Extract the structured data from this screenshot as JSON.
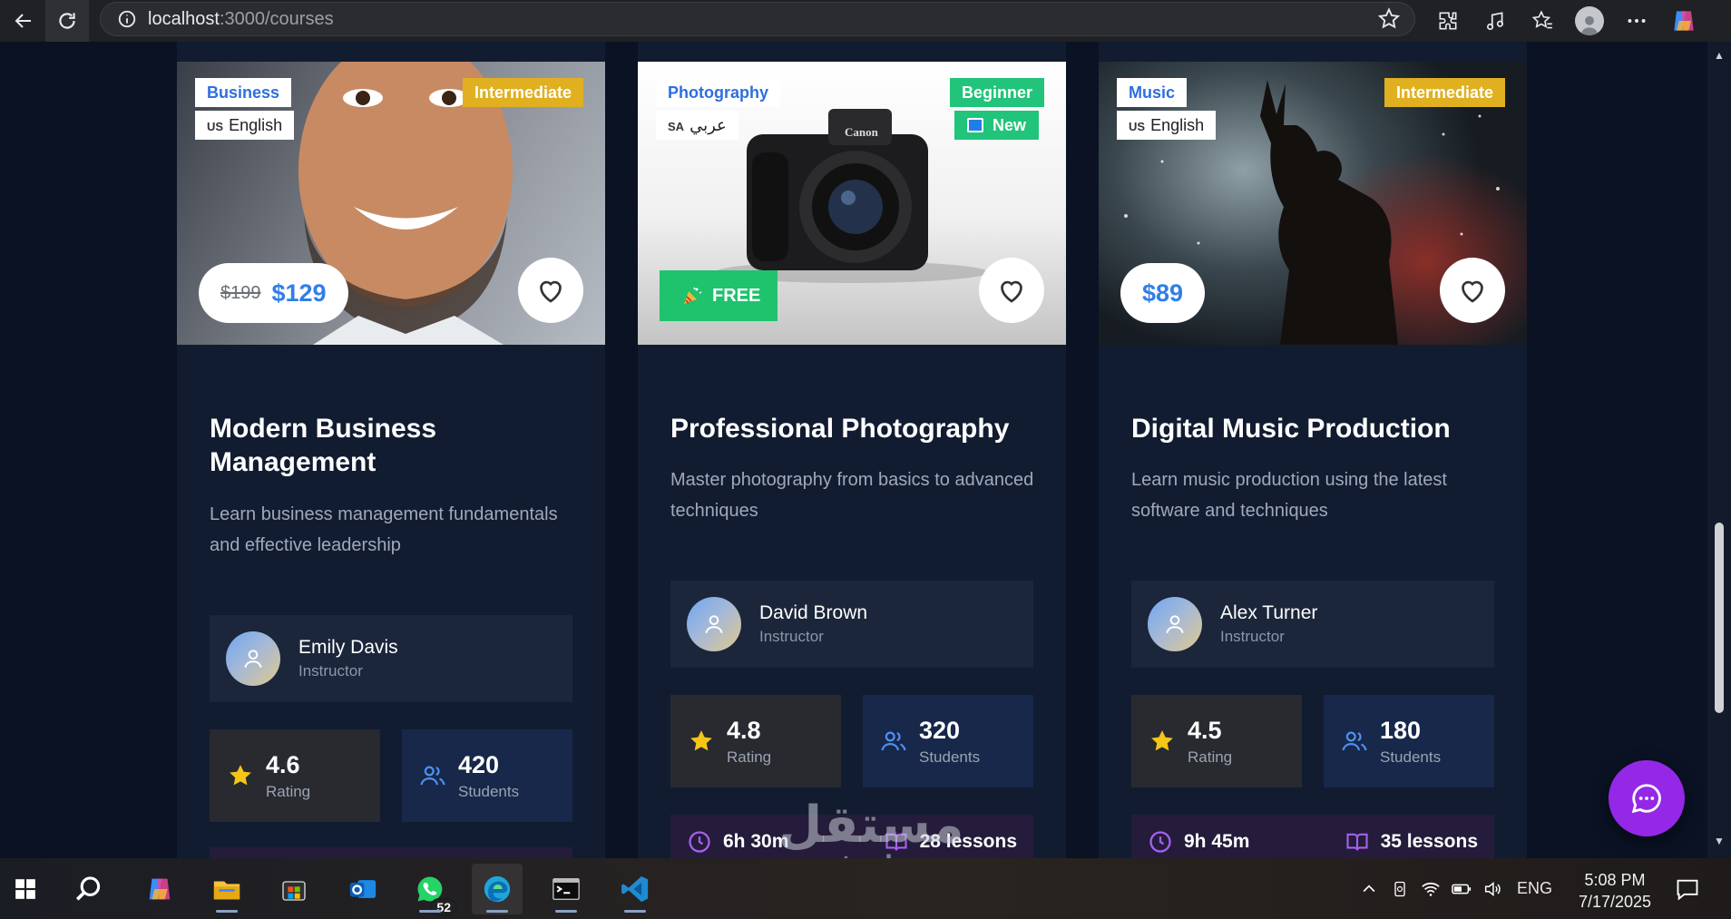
{
  "browser": {
    "url_host": "localhost",
    "url_path": ":3000/courses"
  },
  "courses": [
    {
      "category": "Business",
      "level": "Intermediate",
      "level_color": "#e0b020",
      "lang_code": "US",
      "language": "English",
      "price_old": "$199",
      "price": "$129",
      "title": "Modern Business Management",
      "description": "Learn business management fundamentals and effective leadership",
      "instructor_name": "Emily Davis",
      "instructor_role": "Instructor",
      "rating": "4.6",
      "rating_label": "Rating",
      "students": "420",
      "students_label": "Students"
    },
    {
      "category": "Photography",
      "level": "Beginner",
      "level_color": "#22c37a",
      "new_label": "New",
      "lang_code": "SA",
      "language": "عربي",
      "free_label": "FREE",
      "title": "Professional Photography",
      "description": "Master photography from basics to advanced techniques",
      "instructor_name": "David Brown",
      "instructor_role": "Instructor",
      "rating": "4.8",
      "rating_label": "Rating",
      "students": "320",
      "students_label": "Students",
      "duration": "6h 30m",
      "lessons": "28 lessons"
    },
    {
      "category": "Music",
      "level": "Intermediate",
      "level_color": "#e0b020",
      "lang_code": "US",
      "language": "English",
      "price": "$89",
      "title": "Digital Music Production",
      "description": "Learn music production using the latest software and techniques",
      "instructor_name": "Alex Turner",
      "instructor_role": "Instructor",
      "rating": "4.5",
      "rating_label": "Rating",
      "students": "180",
      "students_label": "Students",
      "duration": "9h 45m",
      "lessons": "35 lessons"
    }
  ],
  "watermark": {
    "arabic": "مستقل",
    "latin": "mostaql.com"
  },
  "taskbar": {
    "whatsapp_badge": "52",
    "language": "ENG",
    "time": "5:08 PM",
    "date": "7/17/2025"
  },
  "colors": {
    "page_bg": "#0a1224",
    "card_bg": "#121c31",
    "accent_blue": "#2f7fe8",
    "free_green": "#1fc26d",
    "chat_purple": "#9428e6",
    "star_yellow": "#f5c518"
  }
}
